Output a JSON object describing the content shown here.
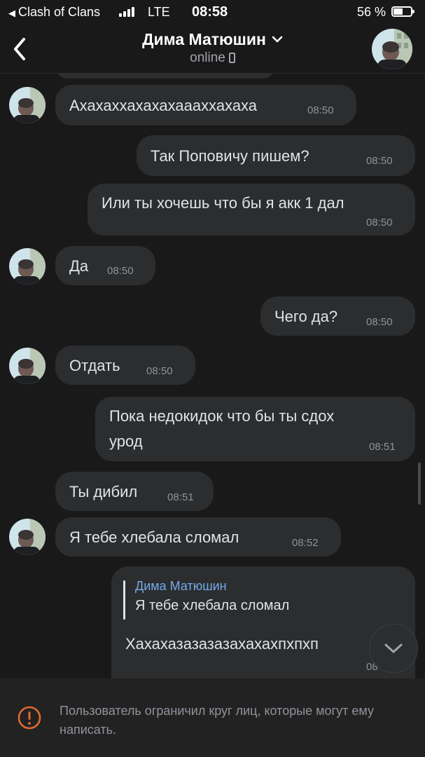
{
  "status_bar": {
    "back_app": "Clash of Clans",
    "network": "LTE",
    "time": "08:58",
    "battery": "56 %",
    "battery_level": 0.56
  },
  "header": {
    "name": "Дима Матюшин",
    "status": "online"
  },
  "messages": [
    {
      "dir": "in",
      "text": "Ахахаххахахахаааххахаха",
      "time": "08:50"
    },
    {
      "dir": "out",
      "text": "Так Поповичу пишем?",
      "time": "08:50"
    },
    {
      "dir": "out",
      "text": "Или ты хочешь что бы я акк 1 дал",
      "time": "08:50"
    },
    {
      "dir": "in",
      "text": "Да",
      "time": "08:50"
    },
    {
      "dir": "out",
      "text": "Чего да?",
      "time": "08:50"
    },
    {
      "dir": "in",
      "text": "Отдать",
      "time": "08:50"
    },
    {
      "dir": "out",
      "text_line1": "Пока недокидок что бы ты сдох",
      "text_line2": "урод",
      "time": "08:51"
    },
    {
      "dir": "in",
      "text": "Ты дибил",
      "time": "08:51"
    },
    {
      "dir": "in",
      "text": "Я тебе хлебала сломал",
      "time": "08:52"
    },
    {
      "dir": "out",
      "reply_name": "Дима Матюшин",
      "reply_text": "Я тебе хлебала сломал",
      "text": "Хахахазазазазахахахпхпхп",
      "time": "08"
    }
  ],
  "footer": {
    "text": "Пользователь ограничил круг лиц, которые могут ему написать."
  },
  "colors": {
    "background": "#19191a",
    "bubble": "#2c2d2e",
    "link": "#71aaeb"
  }
}
